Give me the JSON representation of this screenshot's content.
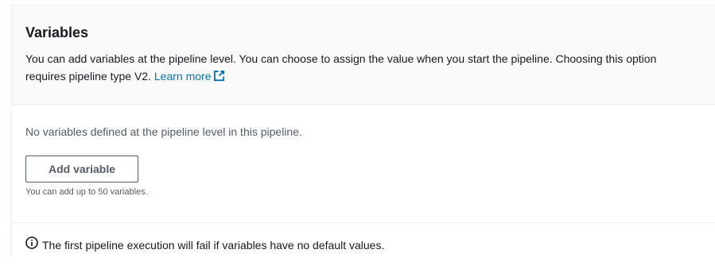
{
  "variables_panel": {
    "title": "Variables",
    "description": "You can add variables at the pipeline level. You can choose to assign the value when you start the pipeline. Choosing this option requires pipeline type V2.",
    "learn_more_label": "Learn more",
    "empty_message": "No variables defined at the pipeline level in this pipeline.",
    "add_button_label": "Add variable",
    "constraint_text": "You can add up to 50 variables.",
    "info_text": "The first pipeline execution will fail if variables have no default values.",
    "icons": {
      "external_link": "external-link-icon",
      "info": "info-icon"
    },
    "colors": {
      "link": "#0073bb",
      "text": "#16191f",
      "secondary_text": "#545b64",
      "header_bg": "#fafafa",
      "border": "#eaeded"
    }
  }
}
